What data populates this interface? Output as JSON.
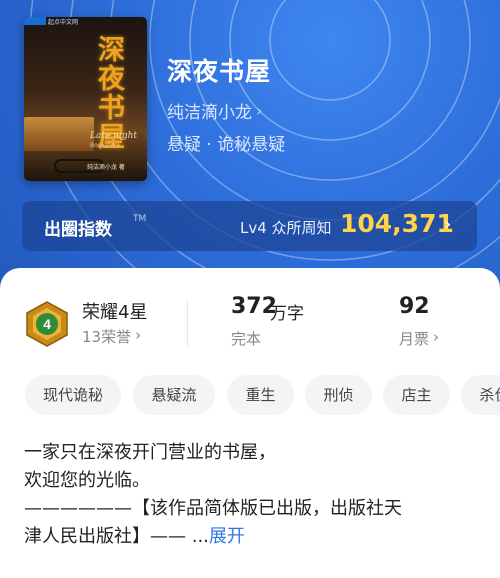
{
  "book": {
    "cover": {
      "title_vertical": "深夜书屋",
      "english_line1": "Late night",
      "english_line2": "Bookstore",
      "author_small": "纯洁滴小龙 著",
      "corner_text": "起点中文网"
    },
    "title": "深夜书屋",
    "author": "纯洁滴小龙",
    "genre": "悬疑 · 诡秘悬疑"
  },
  "index": {
    "label": "出圈指数",
    "tm": "TM",
    "level": "Lv4 众所周知",
    "value": "104,371"
  },
  "stats": {
    "honor_title": "荣耀4星",
    "honor_sub": "13荣誉",
    "badge_number": "4",
    "words_value": "372",
    "words_unit": "万字",
    "words_sub": "完本",
    "tickets_value": "92",
    "tickets_sub": "月票"
  },
  "tags": [
    "现代诡秘",
    "悬疑流",
    "重生",
    "刑侦",
    "店主",
    "杀伐"
  ],
  "description": {
    "line1": "一家只在深夜开门营业的书屋，",
    "line2": "欢迎您的光临。",
    "line3": "——————【该作品简体版已出版，出版社天",
    "line4": "津人民出版社】—— ...",
    "expand": "展开"
  },
  "icons": {
    "chevron": "chevron-right-icon",
    "badge": "honor-badge-icon"
  },
  "colors": {
    "hero_blue": "#2e6fdc",
    "index_value": "#ffd24a",
    "link_blue": "#2f76e6"
  }
}
